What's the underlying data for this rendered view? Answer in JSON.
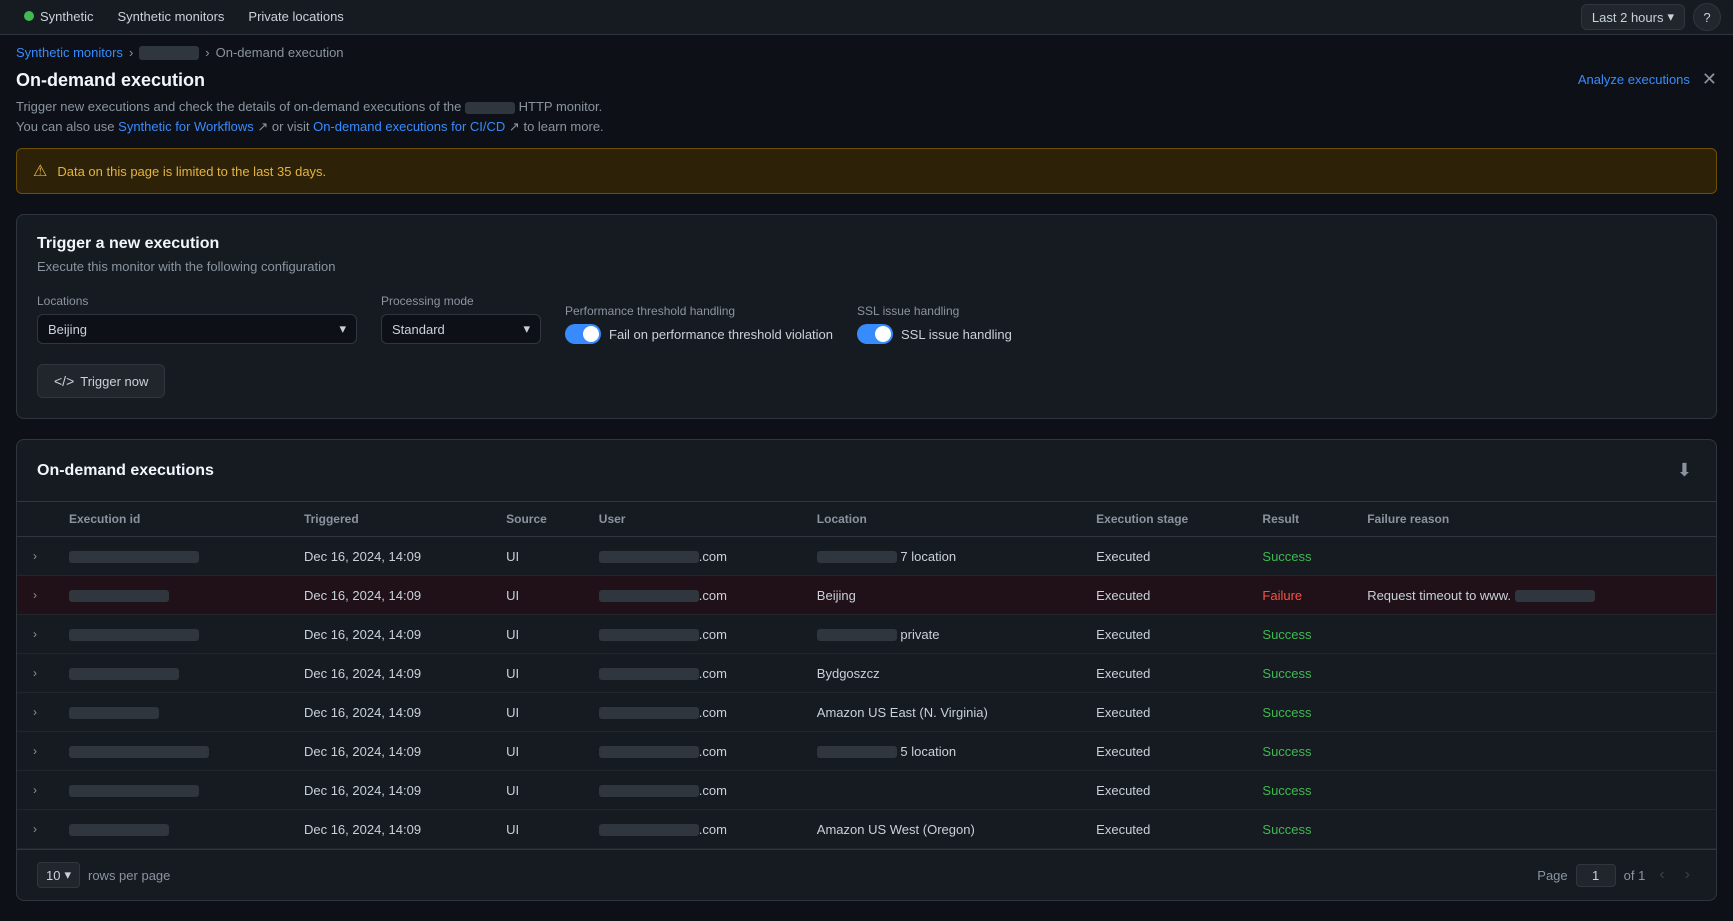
{
  "app": {
    "logo_dot_color": "#3fb950"
  },
  "top_nav": {
    "items": [
      {
        "label": "Synthetic",
        "active": false
      },
      {
        "label": "Synthetic monitors",
        "active": false
      },
      {
        "label": "Private locations",
        "active": false
      }
    ],
    "time_button": "Last 2 hours",
    "time_chevron": "▾",
    "help_label": "?"
  },
  "breadcrumb": {
    "monitors_link": "Synthetic monitors",
    "redacted": true,
    "current": "On-demand execution"
  },
  "page_header": {
    "title": "On-demand execution",
    "description_prefix": "Trigger new executions and check the details of on-demand executions of the",
    "description_suffix": "HTTP monitor.",
    "link1_text": "Synthetic for Workflows",
    "link1_external": true,
    "middle_text": "or visit",
    "link2_text": "On-demand executions for CI/CD",
    "link2_external": true,
    "end_text": "to learn more.",
    "analyze_label": "Analyze executions",
    "close_label": "✕"
  },
  "warning": {
    "text": "Data on this page is limited to the last 35 days."
  },
  "trigger_section": {
    "title": "Trigger a new execution",
    "subtitle": "Execute this monitor with the following configuration",
    "locations_label": "Locations",
    "locations_value": "Beijing",
    "processing_label": "Processing mode",
    "processing_value": "Standard",
    "perf_label": "Performance threshold handling",
    "perf_toggle": true,
    "perf_text": "Fail on performance threshold violation",
    "ssl_label": "SSL issue handling",
    "ssl_toggle": true,
    "ssl_text": "SSL issue handling",
    "trigger_btn": "Trigger now"
  },
  "executions_section": {
    "title": "On-demand executions",
    "columns": [
      "",
      "Execution id",
      "Triggered",
      "Source",
      "User",
      "Location",
      "Execution stage",
      "Result",
      "Failure reason"
    ],
    "rows": [
      {
        "id_width": 130,
        "triggered": "Dec 16, 2024, 14:09",
        "source": "UI",
        "user_width": 100,
        "user_suffix": ".com",
        "location_redacted": true,
        "location_text": "7 location",
        "exec_stage": "Executed",
        "result": "Success",
        "result_class": "result-success",
        "failure": "",
        "highlighted": false
      },
      {
        "id_width": 100,
        "triggered": "Dec 16, 2024, 14:09",
        "source": "UI",
        "user_width": 100,
        "user_suffix": ".com",
        "location_redacted": false,
        "location_text": "Beijing",
        "exec_stage": "Executed",
        "result": "Failure",
        "result_class": "result-failure",
        "failure": "Request timeout to www.",
        "highlighted": true
      },
      {
        "id_width": 130,
        "triggered": "Dec 16, 2024, 14:09",
        "source": "UI",
        "user_width": 100,
        "user_suffix": ".com",
        "location_redacted": true,
        "location_text": "private",
        "exec_stage": "Executed",
        "result": "Success",
        "result_class": "result-success",
        "failure": "",
        "highlighted": false
      },
      {
        "id_width": 110,
        "triggered": "Dec 16, 2024, 14:09",
        "source": "UI",
        "user_width": 100,
        "user_suffix": ".com",
        "location_redacted": false,
        "location_text": "Bydgoszcz",
        "exec_stage": "Executed",
        "result": "Success",
        "result_class": "result-success",
        "failure": "",
        "highlighted": false
      },
      {
        "id_width": 90,
        "triggered": "Dec 16, 2024, 14:09",
        "source": "UI",
        "user_width": 100,
        "user_suffix": ".com",
        "location_redacted": false,
        "location_text": "Amazon US East (N. Virginia)",
        "exec_stage": "Executed",
        "result": "Success",
        "result_class": "result-success",
        "failure": "",
        "highlighted": false
      },
      {
        "id_width": 140,
        "triggered": "Dec 16, 2024, 14:09",
        "source": "UI",
        "user_width": 100,
        "user_suffix": ".com",
        "location_redacted": true,
        "location_text": "5 location",
        "exec_stage": "Executed",
        "result": "Success",
        "result_class": "result-success",
        "failure": "",
        "highlighted": false
      },
      {
        "id_width": 130,
        "triggered": "Dec 16, 2024, 14:09",
        "source": "UI",
        "user_width": 100,
        "user_suffix": ".com",
        "location_redacted": false,
        "location_text": "",
        "exec_stage": "Executed",
        "result": "Success",
        "result_class": "result-success",
        "failure": "",
        "highlighted": false
      },
      {
        "id_width": 100,
        "triggered": "Dec 16, 2024, 14:09",
        "source": "UI",
        "user_width": 100,
        "user_suffix": ".com",
        "location_redacted": false,
        "location_text": "Amazon US West (Oregon)",
        "exec_stage": "Executed",
        "result": "Success",
        "result_class": "result-success",
        "failure": "",
        "highlighted": false
      }
    ]
  },
  "pagination": {
    "rows_per_page": "10",
    "rows_label": "rows per page",
    "page_label": "Page",
    "page_value": "1",
    "of_label": "of 1",
    "of_total": "of 1"
  }
}
